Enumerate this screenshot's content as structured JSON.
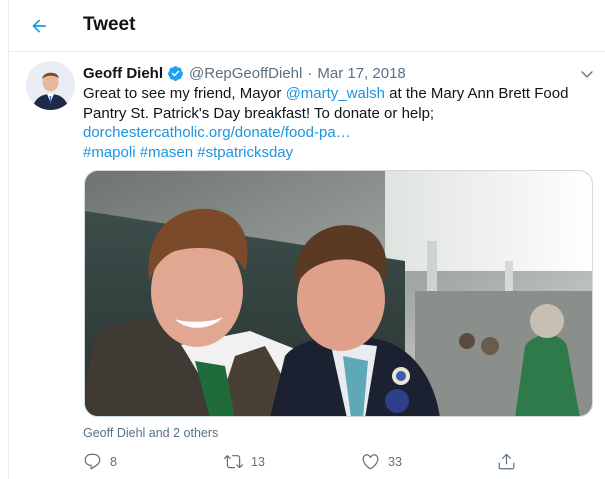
{
  "header": {
    "title": "Tweet",
    "back_icon": "arrow-left-icon"
  },
  "tweet": {
    "author_name": "Geoff Diehl",
    "verified": true,
    "handle": "@RepGeoffDiehl",
    "separator": "·",
    "date": "Mar 17, 2018",
    "text_part1": "Great to see my friend, Mayor ",
    "mention": "@marty_walsh",
    "text_part2": " at the Mary Ann  Brett Food",
    "text_line2": "Pantry St. Patrick's Day breakfast! To donate or help;",
    "url": "dorchestercatholic.org/donate/food-pa…",
    "hashtags": [
      "#mapoli",
      "#masen",
      "#stpatricksday"
    ],
    "likers": "Geoff Diehl and 2 others"
  },
  "actions": {
    "reply_count": "8",
    "retweet_count": "13",
    "like_count": "33"
  },
  "colors": {
    "accent": "#1b95e0",
    "text": "#0f1419",
    "secondary": "#5b7083",
    "border": "#e6ecf0"
  }
}
